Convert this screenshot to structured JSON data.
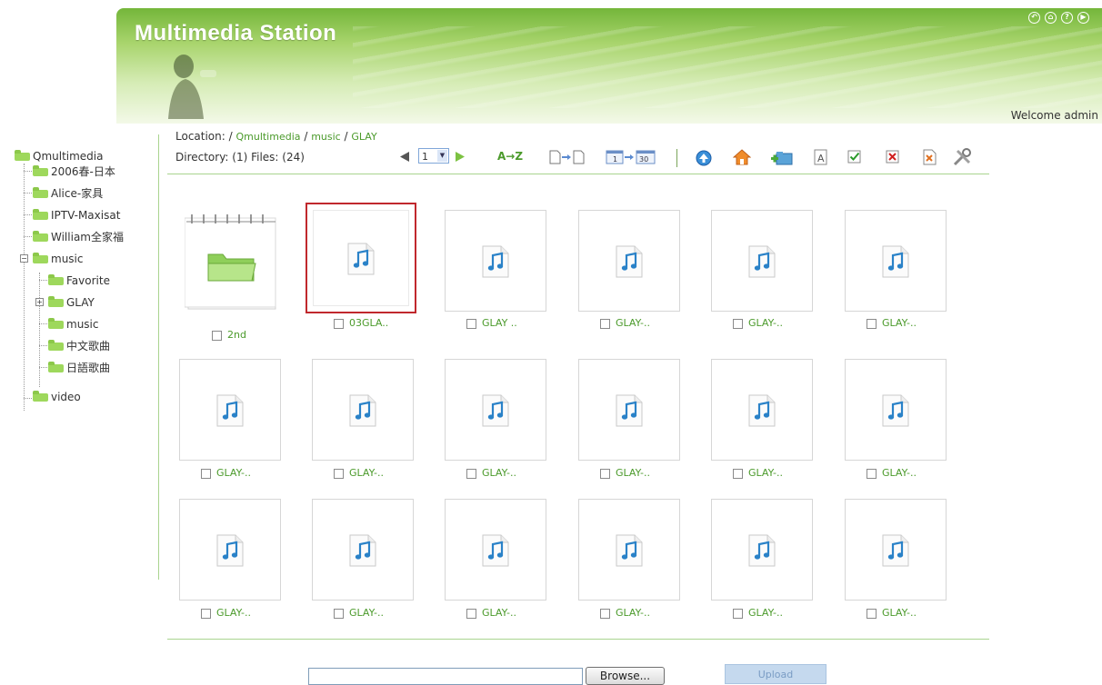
{
  "header": {
    "title": "Multimedia Station",
    "welcome": "Welcome admin",
    "top_icons": [
      "back-icon",
      "home-icon",
      "help-icon",
      "forward-icon"
    ]
  },
  "sidebar": {
    "root": "Qmultimedia",
    "items": [
      {
        "label": "2006春-日本"
      },
      {
        "label": "Alice-家具"
      },
      {
        "label": "IPTV-Maxisat"
      },
      {
        "label": "William全家福"
      },
      {
        "label": "music"
      },
      {
        "label": "Favorite"
      },
      {
        "label": "GLAY"
      },
      {
        "label": "music"
      },
      {
        "label": "中文歌曲"
      },
      {
        "label": "日語歌曲"
      },
      {
        "label": "video"
      }
    ]
  },
  "location": {
    "prefix": "Location: / ",
    "crumbs": [
      "Qmultimedia",
      "music",
      "GLAY"
    ],
    "sep": " / "
  },
  "directory": {
    "text": "Directory: (1) Files: (24)"
  },
  "pager": {
    "page": "1"
  },
  "toolbar": {
    "sort_label": "A→Z",
    "icons": [
      "prev-page-icon",
      "page-select",
      "next-page-icon",
      "sort-az-icon",
      "file-to-file-icon",
      "range-1-30-icon",
      "up-folder-icon",
      "home-folder-icon",
      "new-folder-icon",
      "rename-icon",
      "select-all-icon",
      "deselect-icon",
      "delete-icon",
      "settings-icon"
    ],
    "range_from": "1",
    "range_to": "30"
  },
  "grid": {
    "tiles": [
      {
        "label": "2nd",
        "kind": "folder"
      },
      {
        "label": "03GLA..",
        "kind": "music",
        "selected": true
      },
      {
        "label": "GLAY ..",
        "kind": "music"
      },
      {
        "label": "GLAY-..",
        "kind": "music"
      },
      {
        "label": "GLAY-..",
        "kind": "music"
      },
      {
        "label": "GLAY-..",
        "kind": "music"
      },
      {
        "label": "GLAY-..",
        "kind": "music"
      },
      {
        "label": "GLAY-..",
        "kind": "music"
      },
      {
        "label": "GLAY-..",
        "kind": "music"
      },
      {
        "label": "GLAY-..",
        "kind": "music"
      },
      {
        "label": "GLAY-..",
        "kind": "music"
      },
      {
        "label": "GLAY-..",
        "kind": "music"
      },
      {
        "label": "GLAY-..",
        "kind": "music"
      },
      {
        "label": "GLAY-..",
        "kind": "music"
      },
      {
        "label": "GLAY-..",
        "kind": "music"
      },
      {
        "label": "GLAY-..",
        "kind": "music"
      },
      {
        "label": "GLAY-..",
        "kind": "music"
      },
      {
        "label": "GLAY-..",
        "kind": "music"
      }
    ]
  },
  "upload": {
    "browse_label": "Browse...",
    "upload_label": "Upload"
  },
  "colors": {
    "accent_green": "#4b9a2b",
    "selected_border": "#c0282d",
    "divider": "#a9d48f"
  }
}
